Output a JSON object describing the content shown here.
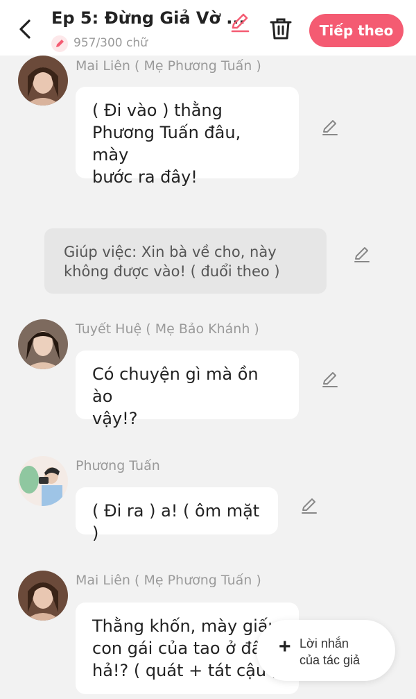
{
  "header": {
    "title": "Ep 5: Đừng Giả Vờ ...",
    "word_count": "957/300 chữ",
    "next_label": "Tiếp theo",
    "accent_color": "#f45b72"
  },
  "messages": [
    {
      "speaker": "Mai Liên ( Mẹ Phương Tuấn )",
      "avatar": "avatar-woman-1",
      "lines": [
        "( Đi vào ) thằng",
        "Phương Tuấn đâu, mày",
        "bước ra đây!"
      ]
    },
    {
      "type": "narration",
      "lines": [
        "Giúp việc: Xin bà về cho, này",
        "không được vào! ( đuổi theo )"
      ]
    },
    {
      "speaker": "Tuyết Huệ ( Mẹ Bảo Khánh )",
      "avatar": "avatar-woman-2",
      "lines": [
        "Có chuyện gì mà ồn ào",
        "vậy!?"
      ]
    },
    {
      "speaker": "Phương Tuấn",
      "avatar": "avatar-man",
      "lines": [
        "( Đi ra ) a! ( ôm mặt )"
      ]
    },
    {
      "speaker": "Mai Liên ( Mẹ Phương Tuấn )",
      "avatar": "avatar-woman-1",
      "lines": [
        "Thằng khốn, mày giấu",
        "con gái của tao ở đâu",
        "hả!? ( quát + tát cậu )"
      ]
    }
  ],
  "author_note": {
    "icon": "plus-icon",
    "line1": "Lời nhắn",
    "line2": "của tác giả"
  }
}
